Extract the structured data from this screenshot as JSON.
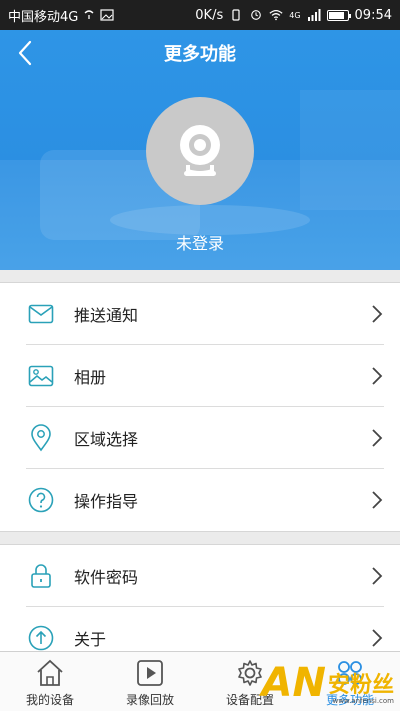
{
  "status_bar": {
    "carrier": "中国移动4G",
    "speed": "0K/s",
    "network": "4G",
    "time": "09:54",
    "battery_level": 0.85
  },
  "header": {
    "title": "更多功能",
    "back_icon": "chevron-left-icon"
  },
  "profile": {
    "avatar_icon": "webcam-icon",
    "status": "未登录"
  },
  "menu": {
    "group1": [
      {
        "label": "推送通知",
        "icon": "mail-icon"
      },
      {
        "label": "相册",
        "icon": "image-icon"
      },
      {
        "label": "区域选择",
        "icon": "location-pin-icon"
      },
      {
        "label": "操作指导",
        "icon": "help-circle-icon"
      }
    ],
    "group2": [
      {
        "label": "软件密码",
        "icon": "lock-icon"
      },
      {
        "label": "关于",
        "icon": "arrow-up-circle-icon"
      }
    ]
  },
  "tabbar": {
    "items": [
      {
        "label": "我的设备",
        "icon": "house-icon"
      },
      {
        "label": "录像回放",
        "icon": "play-icon"
      },
      {
        "label": "设备配置",
        "icon": "gear-icon"
      },
      {
        "label": "更多功能",
        "icon": "grid-circles-icon",
        "active": true
      }
    ]
  },
  "watermark": {
    "logo": "AN",
    "text": "安粉丝",
    "sub": "www.anfensi.com"
  },
  "colors": {
    "primary": "#2b8fe2",
    "accent_icon": "#2aa1b8"
  }
}
